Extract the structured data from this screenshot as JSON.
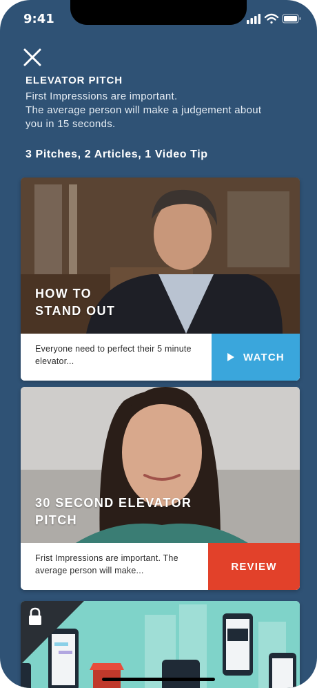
{
  "status_bar": {
    "time": "9:41",
    "icons": [
      "signal-icon",
      "wifi-icon",
      "battery-icon"
    ]
  },
  "header": {
    "close_icon": "close-icon",
    "title": "ELEVATOR PITCH",
    "description_line1": "First Impressions are important.",
    "description_line2": "The average person will make a judgement about you in 15 seconds."
  },
  "summary": "3 Pitches, 2 Articles, 1 Video Tip",
  "cards": [
    {
      "title_line1": "HOW TO",
      "title_line2": "STAND OUT",
      "text": "Everyone need to perfect their 5 minute elevator...",
      "action": "WATCH",
      "action_color": "#3aa6dc"
    },
    {
      "title_line1": "30 SECOND ELEVATOR",
      "title_line2": "PITCH",
      "text": "Frist Impressions are important. The average person will make...",
      "action": "REVIEW",
      "action_color": "#e2412a"
    },
    {
      "locked": true,
      "lock_icon": "lock-icon"
    }
  ],
  "colors": {
    "background": "#2f5275",
    "watch": "#3aa6dc",
    "review": "#e2412a"
  }
}
